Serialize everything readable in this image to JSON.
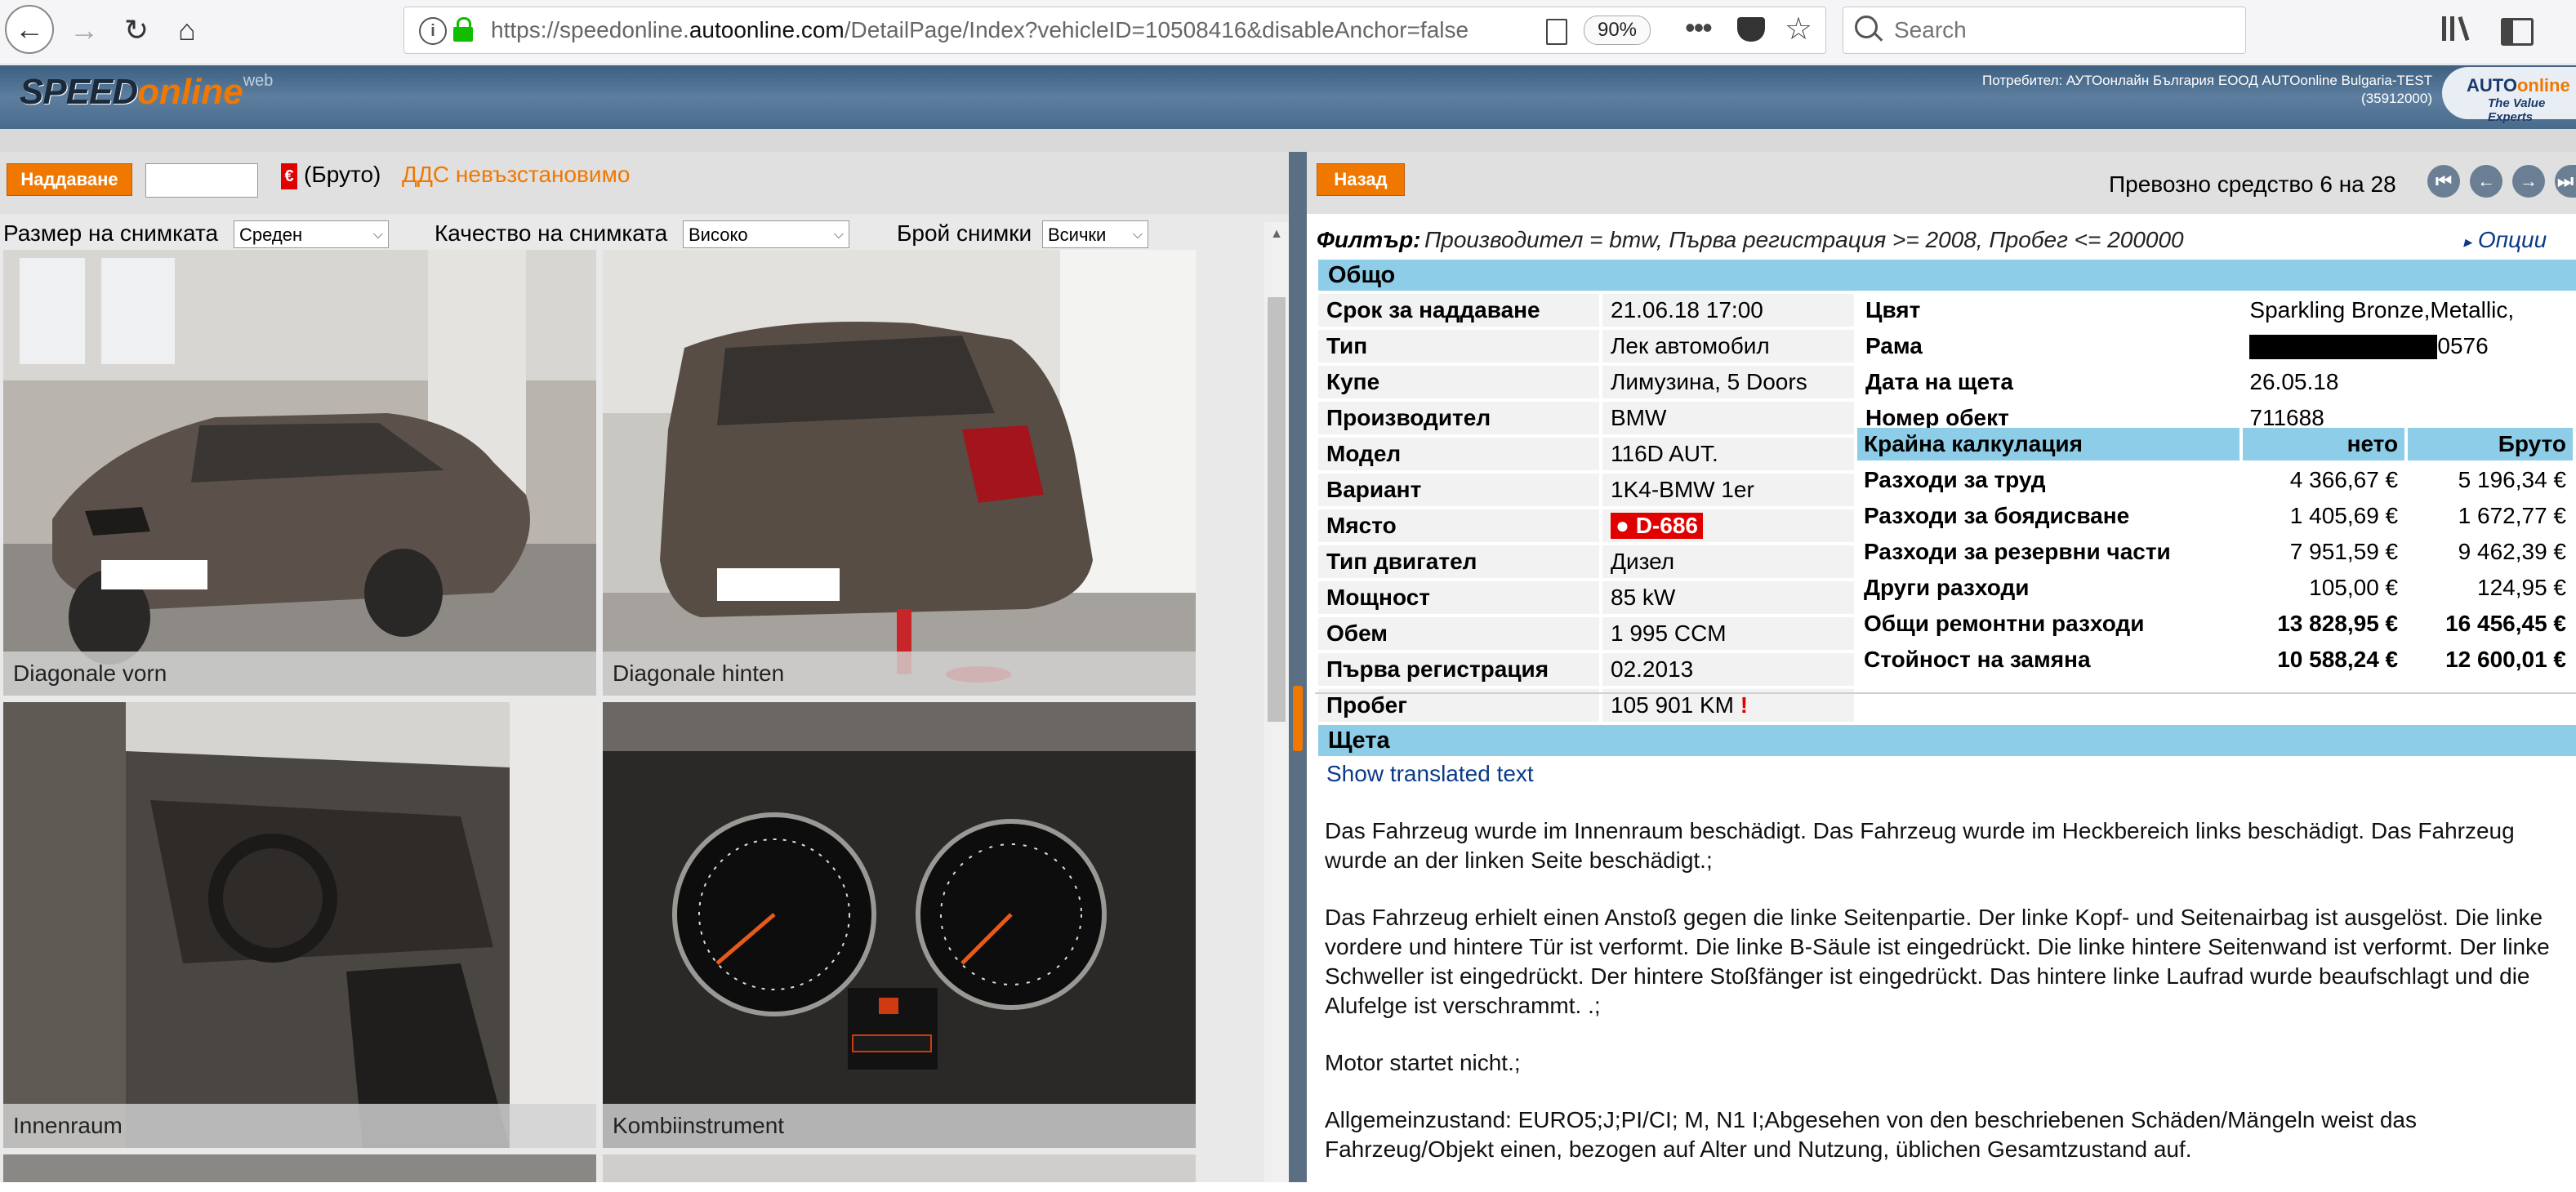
{
  "browser": {
    "url_prefix": "https://speedonline.",
    "url_domain": "autoonline.com",
    "url_path": "/DetailPage/Index?vehicleID=10508416&disableAnchor=false",
    "zoom": "90%",
    "search_placeholder": "Search"
  },
  "header": {
    "logo_speed": "SPEED",
    "logo_online": "online",
    "logo_web": "web",
    "user_line1": "Потребител: АУТОонлайн България ЕООД AUTOonline Bulgaria-TEST",
    "user_line2": "(35912000)",
    "brand_top_a": "AUTO",
    "brand_top_b": "online",
    "brand_tagline": "The Value Experts"
  },
  "left": {
    "bid_button": "Наддаване",
    "gross_symbol": "€",
    "gross_label": "(Бруто)",
    "vat_text": "ДДС невъзстановимо",
    "image_size_label": "Размер на снимката",
    "image_size_value": "Среден",
    "image_quality_label": "Качество на снимката",
    "image_quality_value": "Високо",
    "image_count_label": "Брой снимки",
    "image_count_value": "Всички",
    "photos": [
      {
        "caption": "Diagonale vorn"
      },
      {
        "caption": "Diagonale hinten"
      },
      {
        "caption": "Innenraum"
      },
      {
        "caption": "Kombiinstrument"
      }
    ]
  },
  "right": {
    "back_button": "Назад",
    "vehicle_counter": "Превозно средство 6 на 28",
    "filter_label": "Филтър:",
    "filter_text": "Производител = bmw, Първа регистрация >= 2008, Пробег <= 200000",
    "options_link": "Опции",
    "general_title": "Общо",
    "general": [
      {
        "k": "Срок за наддаване",
        "v": "21.06.18 17:00"
      },
      {
        "k": "Тип",
        "v": "Лек автомобил"
      },
      {
        "k": "Купе",
        "v": "Лимузина, 5 Doors"
      },
      {
        "k": "Производител",
        "v": "BMW"
      },
      {
        "k": "Модел",
        "v": "116D AUT."
      },
      {
        "k": "Вариант",
        "v": "1K4-BMW 1er"
      },
      {
        "k": "Място",
        "v": "D-686"
      },
      {
        "k": "Тип двигател",
        "v": "Дизел"
      },
      {
        "k": "Мощност",
        "v": "85 kW"
      },
      {
        "k": "Обем",
        "v": "1 995 CCM"
      },
      {
        "k": "Първа регистрация",
        "v": "02.2013"
      },
      {
        "k": "Пробег",
        "v": "105 901 KM"
      }
    ],
    "mileage_flag": "!",
    "details": [
      {
        "k": "Цвят",
        "v": "Sparkling Bronze,Metallic,"
      },
      {
        "k": "Рама",
        "v": "0576"
      },
      {
        "k": "Дата на щета",
        "v": "26.05.18"
      },
      {
        "k": "Номер обект",
        "v": "711688"
      }
    ],
    "calc": {
      "title": "Крайна калкулация",
      "net_header": "нето",
      "gross_header": "Бруто",
      "rows": [
        {
          "k": "Разходи за труд",
          "net": "4 366,67 €",
          "gross": "5 196,34 €"
        },
        {
          "k": "Разходи за боядисване",
          "net": "1 405,69 €",
          "gross": "1 672,77 €"
        },
        {
          "k": "Разходи за резервни части",
          "net": "7 951,59 €",
          "gross": "9 462,39 €"
        },
        {
          "k": "Други разходи",
          "net": "105,00 €",
          "gross": "124,95 €"
        },
        {
          "k": "Общи ремонтни разходи",
          "net": "13 828,95 €",
          "gross": "16 456,45 €"
        },
        {
          "k": "Стойност на замяна",
          "net": "10 588,24 €",
          "gross": "12 600,01 €"
        }
      ]
    },
    "damage_title": "Щета",
    "translate_link": "Show translated text",
    "damage_paragraphs": [
      "Das Fahrzeug wurde im Innenraum beschädigt. Das Fahrzeug wurde im Heckbereich links beschädigt. Das Fahrzeug wurde an der linken Seite beschädigt.;",
      "Das Fahrzeug erhielt einen Anstoß gegen die linke Seitenpartie. Der linke Kopf- und Seitenairbag ist ausgelöst. Die linke vordere und hintere Tür ist verformt. Die linke B-Säule ist eingedrückt. Die linke hintere Seitenwand ist verformt. Der linke Schweller ist eingedrückt. Der hintere Stoßfänger ist eingedrückt. Das hintere linke Laufrad wurde beaufschlagt und die Alufelge ist verschrammt. .;",
      "Motor startet nicht.;",
      "Allgemeinzustand: EURO5;J;PI/CI; M, N1 I;Abgesehen von den beschriebenen Schäden/Mängeln weist das Fahrzeug/Objekt einen, bezogen auf Alter und Nutzung, üblichen Gesamtzustand auf."
    ]
  }
}
